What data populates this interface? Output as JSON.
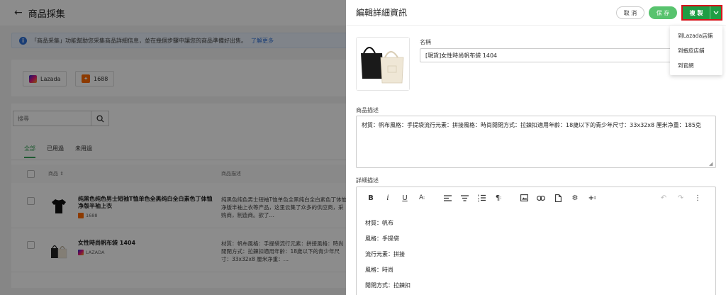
{
  "page": {
    "title": "商品採集",
    "info_text": "「商品采集」功能幫助您采集商品詳細信息，並在幾個步驟中讓您的商品準備好出售。",
    "info_link": "了解更多",
    "platforms": [
      "Lazada",
      "1688"
    ],
    "search": {
      "placeholder": "搜尋"
    },
    "tabs": [
      "全部",
      "已用過",
      "未用過"
    ],
    "table": {
      "col_name": "商品 ⇕",
      "col_desc": "商品描述",
      "rows": [
        {
          "title": "纯黑色纯色男士短袖T恤单色全黑纯白全白素色丁体恤净版半袖上衣",
          "source": "1688",
          "desc": "纯黑色纯色男士短袖T恤单色全黑纯白全白素色丁体恤净版半袖上衣等产品，这里云集了众多的供应商，采购商，制造商。欲了…"
        },
        {
          "title": "女性時尚帆布袋 1404",
          "source": "LAZADA",
          "desc": "材質：帆布風格：手提袋流行元素：拼接風格：時尚閒閉方式：拉鍊扣適用年齡：18歲以下的青少年尺寸：33x32x8 厘米净重：…"
        }
      ]
    }
  },
  "drawer": {
    "title": "編輯詳細資訊",
    "cancel_label": "取 消",
    "save_label": "保 存",
    "copy_label": "複 製",
    "copy_menu": [
      "到Lazada店鋪",
      "到蝦皮店鋪",
      "到官網"
    ],
    "name_label": "名稱",
    "name_value": "[現貨]女性時尚帆布袋 1404",
    "desc_label": "商品描述",
    "desc_value": "材質：帆布風格：手提袋流行元素：拼接風格：時尚閒閉方式：拉鍊扣適用年齡：18歲以下的青少年尺寸：33x32x8 厘米净重：185克",
    "detail_label": "詳細描述",
    "detail_lines": [
      "材質：帆布",
      "風格：手提袋",
      "流行元素：拼接",
      "風格：時尚",
      "閒閉方式：拉鍊扣"
    ]
  },
  "colors": {
    "accent_green": "#1f9d44",
    "save_green": "#58c36e",
    "highlight_red": "#d6141c",
    "link_blue": "#2f6fd6"
  }
}
